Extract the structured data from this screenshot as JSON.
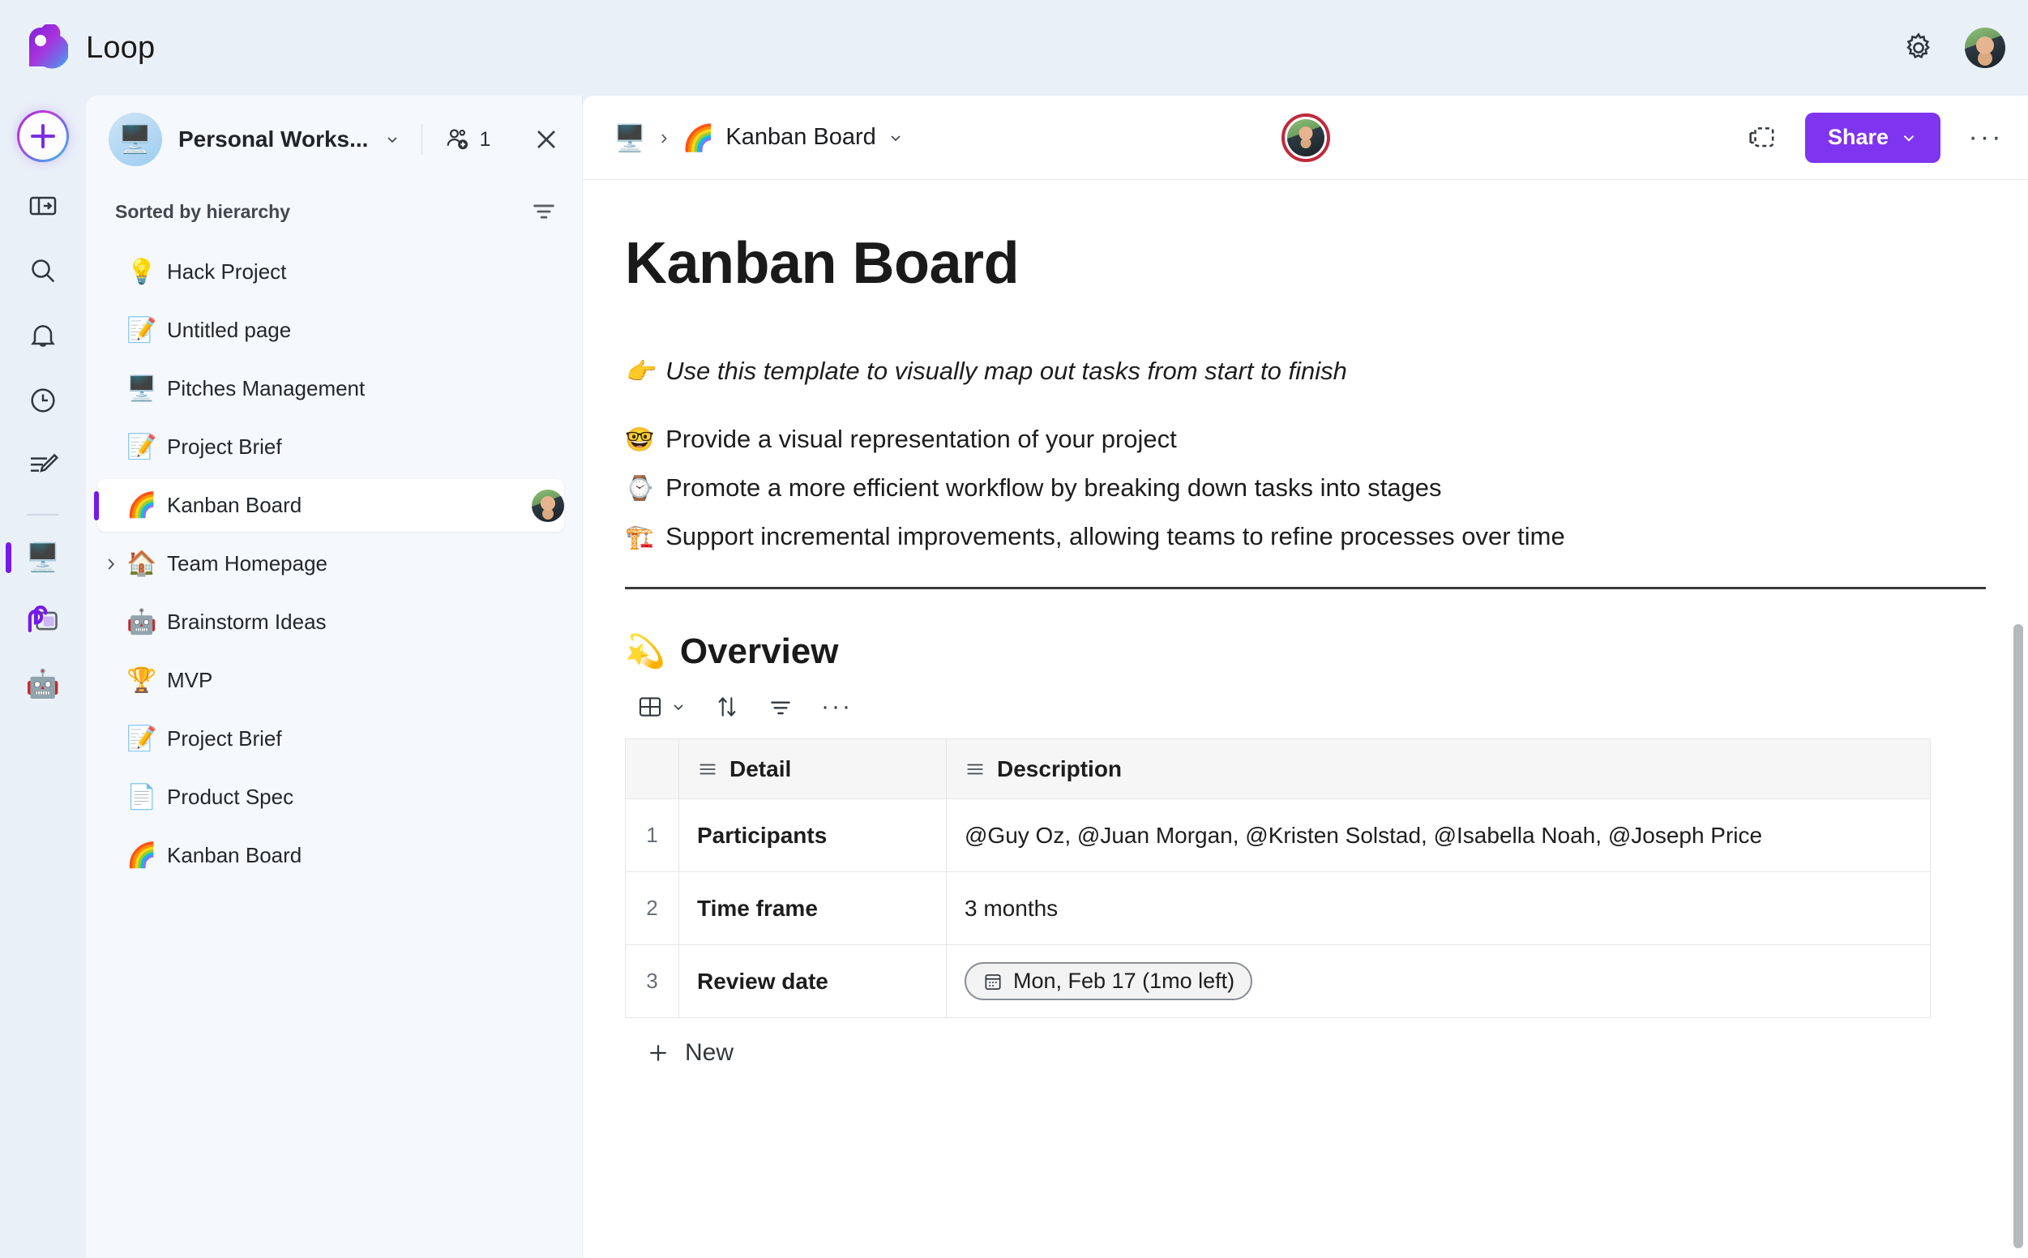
{
  "app": {
    "brand_name": "Loop",
    "logo_icon": "loop-logo",
    "settings_icon": "gear-icon",
    "avatar_icon": "user-avatar"
  },
  "rail": {
    "add_icon": "plus-icon",
    "items": [
      {
        "name": "expand-panel",
        "icon": "panel-expand-icon"
      },
      {
        "name": "search",
        "icon": "search-icon"
      },
      {
        "name": "notifications",
        "icon": "bell-icon"
      },
      {
        "name": "recent",
        "icon": "clock-icon"
      },
      {
        "name": "ideas",
        "icon": "edit-lines-icon"
      }
    ],
    "workspaces": [
      {
        "name": "personal-workspace",
        "emoji": "🖥️",
        "active": true
      },
      {
        "name": "loop-workspace",
        "emoji": "",
        "active": false
      },
      {
        "name": "brainstorm-workspace",
        "emoji": "🤖",
        "active": false
      }
    ]
  },
  "sidebar": {
    "workspace_name": "Personal Works...",
    "workspace_emoji": "🖥️",
    "workspace_chevron_icon": "chevron-down-icon",
    "people_icon": "add-person-icon",
    "people_count": "1",
    "close_icon": "close-icon",
    "sorted_label": "Sorted by hierarchy",
    "sort_filter_icon": "filter-icon",
    "items": [
      {
        "emoji": "💡",
        "label": "Hack Project",
        "selected": false,
        "expandable": false,
        "avatar": false
      },
      {
        "emoji": "📝",
        "label": "Untitled page",
        "selected": false,
        "expandable": false,
        "avatar": false
      },
      {
        "emoji": "🖥️",
        "label": "Pitches Management",
        "selected": false,
        "expandable": false,
        "avatar": false
      },
      {
        "emoji": "📝",
        "label": "Project Brief",
        "selected": false,
        "expandable": false,
        "avatar": false
      },
      {
        "emoji": "🌈",
        "label": "Kanban Board",
        "selected": true,
        "expandable": false,
        "avatar": true
      },
      {
        "emoji": "🏠",
        "label": "Team Homepage",
        "selected": false,
        "expandable": true,
        "avatar": false
      },
      {
        "emoji": "🤖",
        "label": "Brainstorm Ideas",
        "selected": false,
        "expandable": false,
        "avatar": false
      },
      {
        "emoji": "🏆",
        "label": "MVP",
        "selected": false,
        "expandable": false,
        "avatar": false
      },
      {
        "emoji": "📝",
        "label": "Project Brief",
        "selected": false,
        "expandable": false,
        "avatar": false
      },
      {
        "emoji": "📄",
        "label": "Product Spec",
        "selected": false,
        "expandable": false,
        "avatar": false
      },
      {
        "emoji": "🌈",
        "label": "Kanban Board",
        "selected": false,
        "expandable": false,
        "avatar": false
      }
    ]
  },
  "doc_header": {
    "breadcrumb_root_emoji": "🖥️",
    "breadcrumb_separator": "›",
    "breadcrumb_current_emoji": "🌈",
    "breadcrumb_current": "Kanban Board",
    "breadcrumb_chevron_icon": "chevron-down-icon",
    "presence_icon": "presence-avatar",
    "copy_icon": "copy-component-icon",
    "share_label": "Share",
    "share_chevron_icon": "chevron-down-icon",
    "more_icon": "more-horizontal-icon",
    "share_color": "#7f34ef"
  },
  "document": {
    "title": "Kanban Board",
    "intro": {
      "emoji": "👉",
      "text": "Use this template to visually map out tasks from start to finish"
    },
    "bullets": [
      {
        "emoji": "🤓",
        "text": "Provide a visual representation of your project"
      },
      {
        "emoji": "⌚",
        "text": "Promote a more efficient workflow by breaking down tasks into stages"
      },
      {
        "emoji": "🏗️",
        "text": "Support incremental improvements, allowing teams to refine processes over time"
      }
    ],
    "overview": {
      "emoji": "💫",
      "heading": "Overview",
      "toolbar": {
        "view_icon": "grid-view-icon",
        "view_chevron_icon": "chevron-down-icon",
        "sort_icon": "sort-arrows-icon",
        "filter_icon": "filter-icon",
        "more_icon": "more-horizontal-icon"
      },
      "table": {
        "column_icon": "text-field-icon",
        "headers": [
          "Detail",
          "Description"
        ],
        "rows": [
          {
            "index": "1",
            "detail": "Participants",
            "description": "@Guy Oz, @Juan Morgan, @Kristen Solstad, @Isabella Noah, @Joseph Price",
            "is_date": false
          },
          {
            "index": "2",
            "detail": "Time frame",
            "description": "3 months",
            "is_date": false
          },
          {
            "index": "3",
            "detail": "Review date",
            "description": "Mon, Feb 17 (1mo left)",
            "is_date": true
          }
        ],
        "new_row_label": "New",
        "new_row_icon": "plus-icon",
        "date_icon": "calendar-icon"
      }
    }
  }
}
